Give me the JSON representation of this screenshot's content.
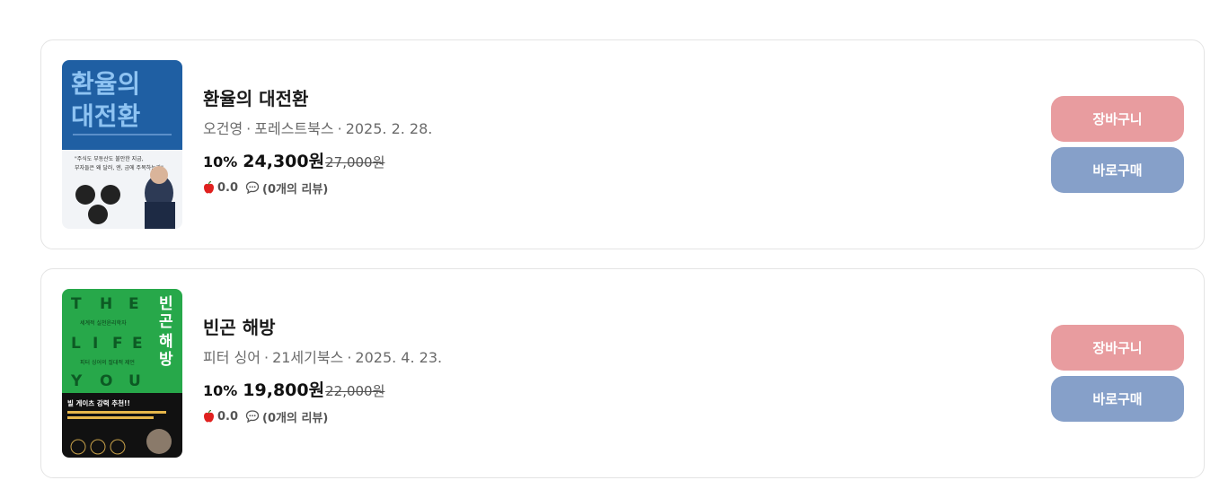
{
  "books": [
    {
      "title": "환율의 대전환",
      "author": "오건영",
      "publisher": "포레스트북스",
      "date": "2025. 2. 28.",
      "discount": "10%",
      "sale_price": "24,300원",
      "original_price": "27,000원",
      "rating": "0.0",
      "reviews": "(0개의 리뷰)",
      "cart_label": "장바구니",
      "buy_label": "바로구매",
      "cover": {
        "title_line1": "환율의",
        "title_line2": "대전환",
        "tagline": "\"주식도 부동산도 불안한 지금, 부자들은 왜 달러, 엔, 금에 주목하는가\"",
        "bg_color": "#1f5fa3",
        "accent_color": "#8ec3f2"
      }
    },
    {
      "title": "빈곤 해방",
      "author": "피터 싱어",
      "publisher": "21세기북스",
      "date": "2025. 4. 23.",
      "discount": "10%",
      "sale_price": "19,800원",
      "original_price": "22,000원",
      "rating": "0.0",
      "reviews": "(0개의 리뷰)",
      "cart_label": "장바구니",
      "buy_label": "바로구매",
      "cover": {
        "letters": [
          "T",
          "H",
          "E",
          "L",
          "I",
          "F",
          "E",
          "Y",
          "O",
          "U"
        ],
        "title_vertical": "빈곤 해방",
        "subtitle": "세계적 실천윤리학자",
        "subtitle2": "피터 싱어의 절대적 제언",
        "badge": "빌 게이츠 강력 추천!!",
        "bg_color": "#27a84a",
        "bottom_color": "#111111"
      }
    }
  ],
  "colors": {
    "cart": "#e89c9f",
    "buy": "#86a0c9",
    "apple": "#e0211f"
  }
}
